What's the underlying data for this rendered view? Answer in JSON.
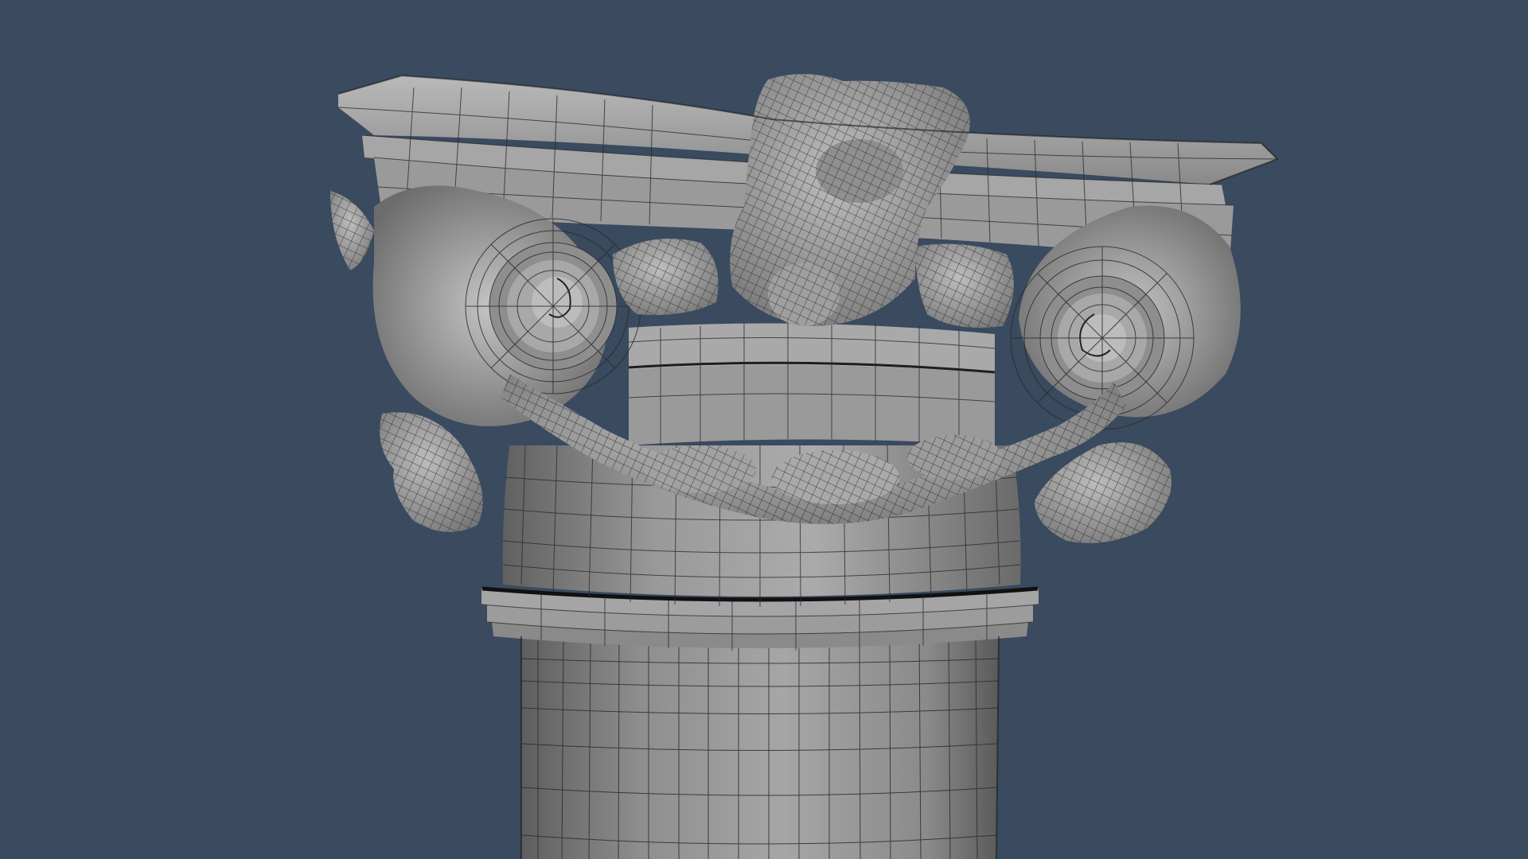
{
  "viewport": {
    "background_color": "#3a4a5f",
    "shading": "smooth-shaded-with-wireframe-on-shaded",
    "subject": "ionic-column-capital-with-garland"
  },
  "colors": {
    "mesh_fill": "#9d9d9d",
    "mesh_fill_light": "#b4b4b4",
    "mesh_fill_dark": "#6e6e6e",
    "wire": "#2a2a2a"
  }
}
